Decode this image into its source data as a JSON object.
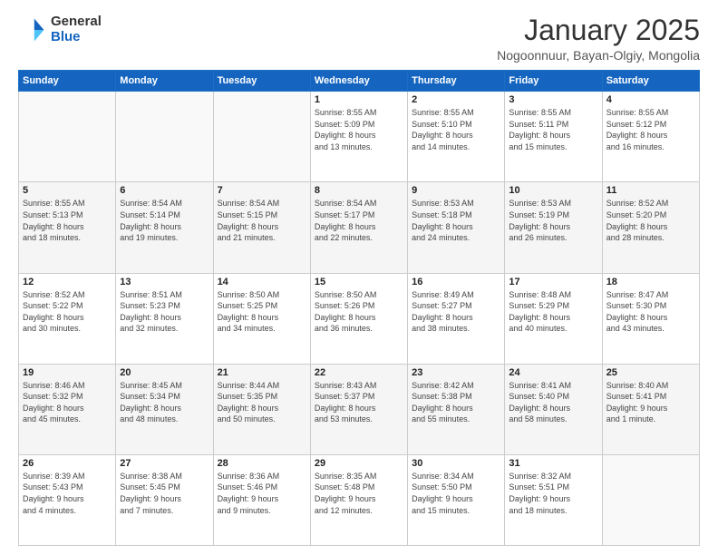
{
  "logo": {
    "general": "General",
    "blue": "Blue"
  },
  "title": {
    "month": "January 2025",
    "location": "Nogoonnuur, Bayan-Olgiy, Mongolia"
  },
  "days_header": [
    "Sunday",
    "Monday",
    "Tuesday",
    "Wednesday",
    "Thursday",
    "Friday",
    "Saturday"
  ],
  "weeks": [
    [
      {
        "day": "",
        "info": ""
      },
      {
        "day": "",
        "info": ""
      },
      {
        "day": "",
        "info": ""
      },
      {
        "day": "1",
        "info": "Sunrise: 8:55 AM\nSunset: 5:09 PM\nDaylight: 8 hours\nand 13 minutes."
      },
      {
        "day": "2",
        "info": "Sunrise: 8:55 AM\nSunset: 5:10 PM\nDaylight: 8 hours\nand 14 minutes."
      },
      {
        "day": "3",
        "info": "Sunrise: 8:55 AM\nSunset: 5:11 PM\nDaylight: 8 hours\nand 15 minutes."
      },
      {
        "day": "4",
        "info": "Sunrise: 8:55 AM\nSunset: 5:12 PM\nDaylight: 8 hours\nand 16 minutes."
      }
    ],
    [
      {
        "day": "5",
        "info": "Sunrise: 8:55 AM\nSunset: 5:13 PM\nDaylight: 8 hours\nand 18 minutes."
      },
      {
        "day": "6",
        "info": "Sunrise: 8:54 AM\nSunset: 5:14 PM\nDaylight: 8 hours\nand 19 minutes."
      },
      {
        "day": "7",
        "info": "Sunrise: 8:54 AM\nSunset: 5:15 PM\nDaylight: 8 hours\nand 21 minutes."
      },
      {
        "day": "8",
        "info": "Sunrise: 8:54 AM\nSunset: 5:17 PM\nDaylight: 8 hours\nand 22 minutes."
      },
      {
        "day": "9",
        "info": "Sunrise: 8:53 AM\nSunset: 5:18 PM\nDaylight: 8 hours\nand 24 minutes."
      },
      {
        "day": "10",
        "info": "Sunrise: 8:53 AM\nSunset: 5:19 PM\nDaylight: 8 hours\nand 26 minutes."
      },
      {
        "day": "11",
        "info": "Sunrise: 8:52 AM\nSunset: 5:20 PM\nDaylight: 8 hours\nand 28 minutes."
      }
    ],
    [
      {
        "day": "12",
        "info": "Sunrise: 8:52 AM\nSunset: 5:22 PM\nDaylight: 8 hours\nand 30 minutes."
      },
      {
        "day": "13",
        "info": "Sunrise: 8:51 AM\nSunset: 5:23 PM\nDaylight: 8 hours\nand 32 minutes."
      },
      {
        "day": "14",
        "info": "Sunrise: 8:50 AM\nSunset: 5:25 PM\nDaylight: 8 hours\nand 34 minutes."
      },
      {
        "day": "15",
        "info": "Sunrise: 8:50 AM\nSunset: 5:26 PM\nDaylight: 8 hours\nand 36 minutes."
      },
      {
        "day": "16",
        "info": "Sunrise: 8:49 AM\nSunset: 5:27 PM\nDaylight: 8 hours\nand 38 minutes."
      },
      {
        "day": "17",
        "info": "Sunrise: 8:48 AM\nSunset: 5:29 PM\nDaylight: 8 hours\nand 40 minutes."
      },
      {
        "day": "18",
        "info": "Sunrise: 8:47 AM\nSunset: 5:30 PM\nDaylight: 8 hours\nand 43 minutes."
      }
    ],
    [
      {
        "day": "19",
        "info": "Sunrise: 8:46 AM\nSunset: 5:32 PM\nDaylight: 8 hours\nand 45 minutes."
      },
      {
        "day": "20",
        "info": "Sunrise: 8:45 AM\nSunset: 5:34 PM\nDaylight: 8 hours\nand 48 minutes."
      },
      {
        "day": "21",
        "info": "Sunrise: 8:44 AM\nSunset: 5:35 PM\nDaylight: 8 hours\nand 50 minutes."
      },
      {
        "day": "22",
        "info": "Sunrise: 8:43 AM\nSunset: 5:37 PM\nDaylight: 8 hours\nand 53 minutes."
      },
      {
        "day": "23",
        "info": "Sunrise: 8:42 AM\nSunset: 5:38 PM\nDaylight: 8 hours\nand 55 minutes."
      },
      {
        "day": "24",
        "info": "Sunrise: 8:41 AM\nSunset: 5:40 PM\nDaylight: 8 hours\nand 58 minutes."
      },
      {
        "day": "25",
        "info": "Sunrise: 8:40 AM\nSunset: 5:41 PM\nDaylight: 9 hours\nand 1 minute."
      }
    ],
    [
      {
        "day": "26",
        "info": "Sunrise: 8:39 AM\nSunset: 5:43 PM\nDaylight: 9 hours\nand 4 minutes."
      },
      {
        "day": "27",
        "info": "Sunrise: 8:38 AM\nSunset: 5:45 PM\nDaylight: 9 hours\nand 7 minutes."
      },
      {
        "day": "28",
        "info": "Sunrise: 8:36 AM\nSunset: 5:46 PM\nDaylight: 9 hours\nand 9 minutes."
      },
      {
        "day": "29",
        "info": "Sunrise: 8:35 AM\nSunset: 5:48 PM\nDaylight: 9 hours\nand 12 minutes."
      },
      {
        "day": "30",
        "info": "Sunrise: 8:34 AM\nSunset: 5:50 PM\nDaylight: 9 hours\nand 15 minutes."
      },
      {
        "day": "31",
        "info": "Sunrise: 8:32 AM\nSunset: 5:51 PM\nDaylight: 9 hours\nand 18 minutes."
      },
      {
        "day": "",
        "info": ""
      }
    ]
  ]
}
